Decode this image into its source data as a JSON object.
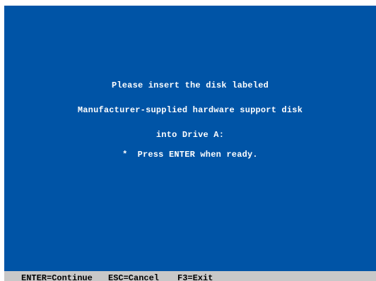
{
  "screen": {
    "background_color": "#0054a6",
    "text_color": "#ffffff",
    "status_bar_color": "#c8c8c8"
  },
  "message": {
    "line1": "Please insert the disk labeled",
    "line2": "Manufacturer-supplied hardware support disk",
    "line3": "into Drive A:",
    "bullet": "*",
    "line4": "Press ENTER when ready."
  },
  "status_bar": {
    "enter": "ENTER=Continue",
    "esc": "ESC=Cancel",
    "f3": "F3=Exit"
  }
}
